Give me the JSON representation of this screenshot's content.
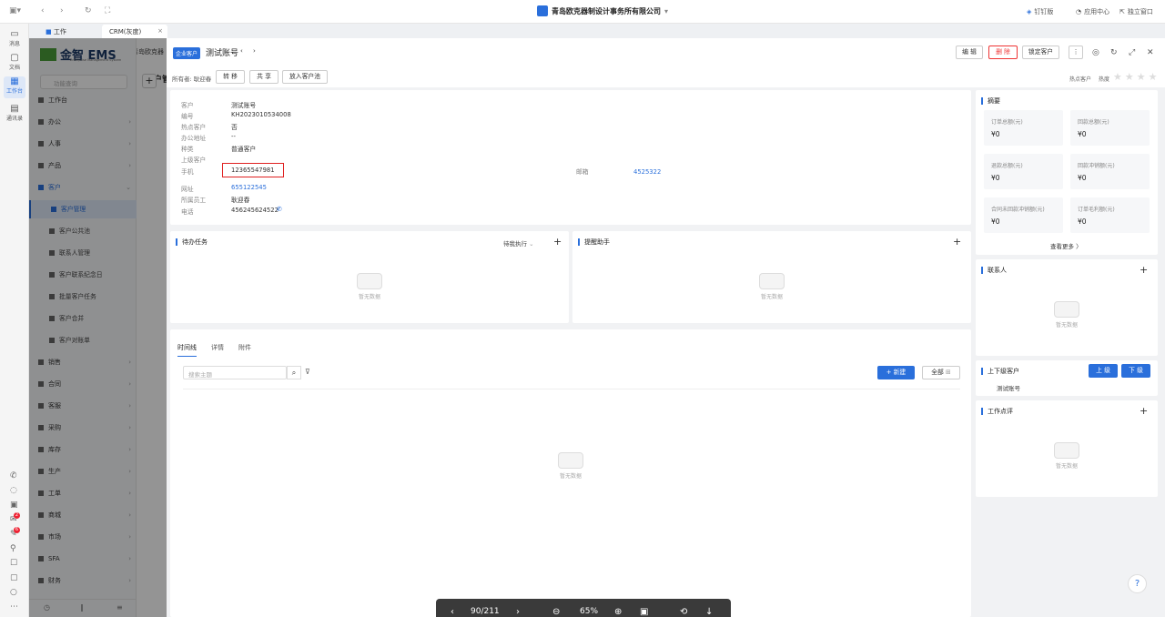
{
  "topbar": {
    "app_title": "青岛欧克器制设计事务所有限公司",
    "right": [
      {
        "icon": "dingtalk-icon",
        "label": "钉钉版"
      },
      {
        "icon": "app-center-icon",
        "label": "应用中心"
      },
      {
        "icon": "popout-icon",
        "label": "独立窗口"
      }
    ]
  },
  "rail": {
    "items": [
      {
        "icon": "message-icon",
        "label": "消息"
      },
      {
        "icon": "docs-icon",
        "label": "文档"
      },
      {
        "icon": "workbench-icon",
        "label": "工作台"
      },
      {
        "icon": "contacts-icon",
        "label": "通讯录"
      }
    ],
    "badges": [
      "2",
      "6"
    ]
  },
  "tabs": [
    {
      "label": "工作",
      "icon": "work-icon"
    },
    {
      "label": "CRM(灰度)"
    }
  ],
  "sidebar": {
    "brand": "金智 EMS",
    "brand_sub": "Enterprise Management System",
    "search_placeholder": "功能查询",
    "header_snippet": "青岛欧克器",
    "content_snippet": "客户管",
    "workbench": "工作台",
    "items": [
      {
        "label": "办公"
      },
      {
        "label": "人事"
      },
      {
        "label": "产品"
      },
      {
        "label": "客户"
      }
    ],
    "sub_items": [
      {
        "label": "客户管理",
        "selected": true
      },
      {
        "label": "客户公共池"
      },
      {
        "label": "联系人管理"
      },
      {
        "label": "客户联系纪念日"
      },
      {
        "label": "批量客户任务"
      },
      {
        "label": "客户合并"
      },
      {
        "label": "客户对账单"
      }
    ],
    "more_items": [
      {
        "label": "销售"
      },
      {
        "label": "合同"
      },
      {
        "label": "客服"
      },
      {
        "label": "采购"
      },
      {
        "label": "库存"
      },
      {
        "label": "生产"
      },
      {
        "label": "工单"
      },
      {
        "label": "商城"
      },
      {
        "label": "市场"
      },
      {
        "label": "SFA"
      },
      {
        "label": "财务"
      }
    ]
  },
  "drawer": {
    "tag": "企业客户",
    "title": "测试账号",
    "buttons": {
      "edit": "编 辑",
      "delete": "删 除",
      "lock": "锁定客户"
    },
    "owner_label": "所有者: 耿迎春",
    "sub_buttons": {
      "transfer": "转 移",
      "share": "共 享",
      "to_pool": "放入客户池"
    },
    "hot_label": "热点客户",
    "heat_label": "热度",
    "fields": [
      {
        "label": "客户",
        "value": "测试账号"
      },
      {
        "label": "编号",
        "value": "KH2023010534008"
      },
      {
        "label": "热点客户",
        "value": "否"
      },
      {
        "label": "办公地址",
        "value": "--"
      },
      {
        "label": "种类",
        "value": "普通客户"
      },
      {
        "label": "上级客户",
        "value": ""
      },
      {
        "label": "手机",
        "value": "12365547981"
      },
      {
        "label": "网址",
        "value": "655122545"
      },
      {
        "label": "所属员工",
        "value": "耿迎春"
      },
      {
        "label": "电话",
        "value": "456245624522"
      }
    ],
    "email_label": "邮箱",
    "email_value": "4525322",
    "todo": {
      "title": "待办任务",
      "filter": "待我执行",
      "empty": "暂无数据"
    },
    "reminder": {
      "title": "提醒助手",
      "empty": "暂无数据"
    },
    "timeline": {
      "tabs": [
        "时间线",
        "详情",
        "附件"
      ],
      "search_placeholder": "搜索主题",
      "new_button": "+ 新建",
      "all_button": "全部",
      "empty": "暂无数据"
    },
    "summary": {
      "title": "摘要",
      "stats": [
        {
          "label": "订单总额(元)",
          "value": "¥0"
        },
        {
          "label": "回款总额(元)",
          "value": "¥0"
        },
        {
          "label": "退款总额(元)",
          "value": "¥0"
        },
        {
          "label": "回款冲销额(元)",
          "value": "¥0"
        },
        {
          "label": "合同未回款冲销额(元)",
          "value": "¥0"
        },
        {
          "label": "订单毛利额(元)",
          "value": "¥0"
        }
      ],
      "more": "查看更多 〉"
    },
    "contacts": {
      "title": "联系人",
      "empty": "暂无数据"
    },
    "parent_child": {
      "title": "上下级客户",
      "up": "上 级",
      "down": "下 级",
      "item": "测试账号"
    },
    "review": {
      "title": "工作点评",
      "empty": "暂无数据"
    }
  },
  "pdf_bar": {
    "page": "90/211",
    "zoom": "65%"
  }
}
